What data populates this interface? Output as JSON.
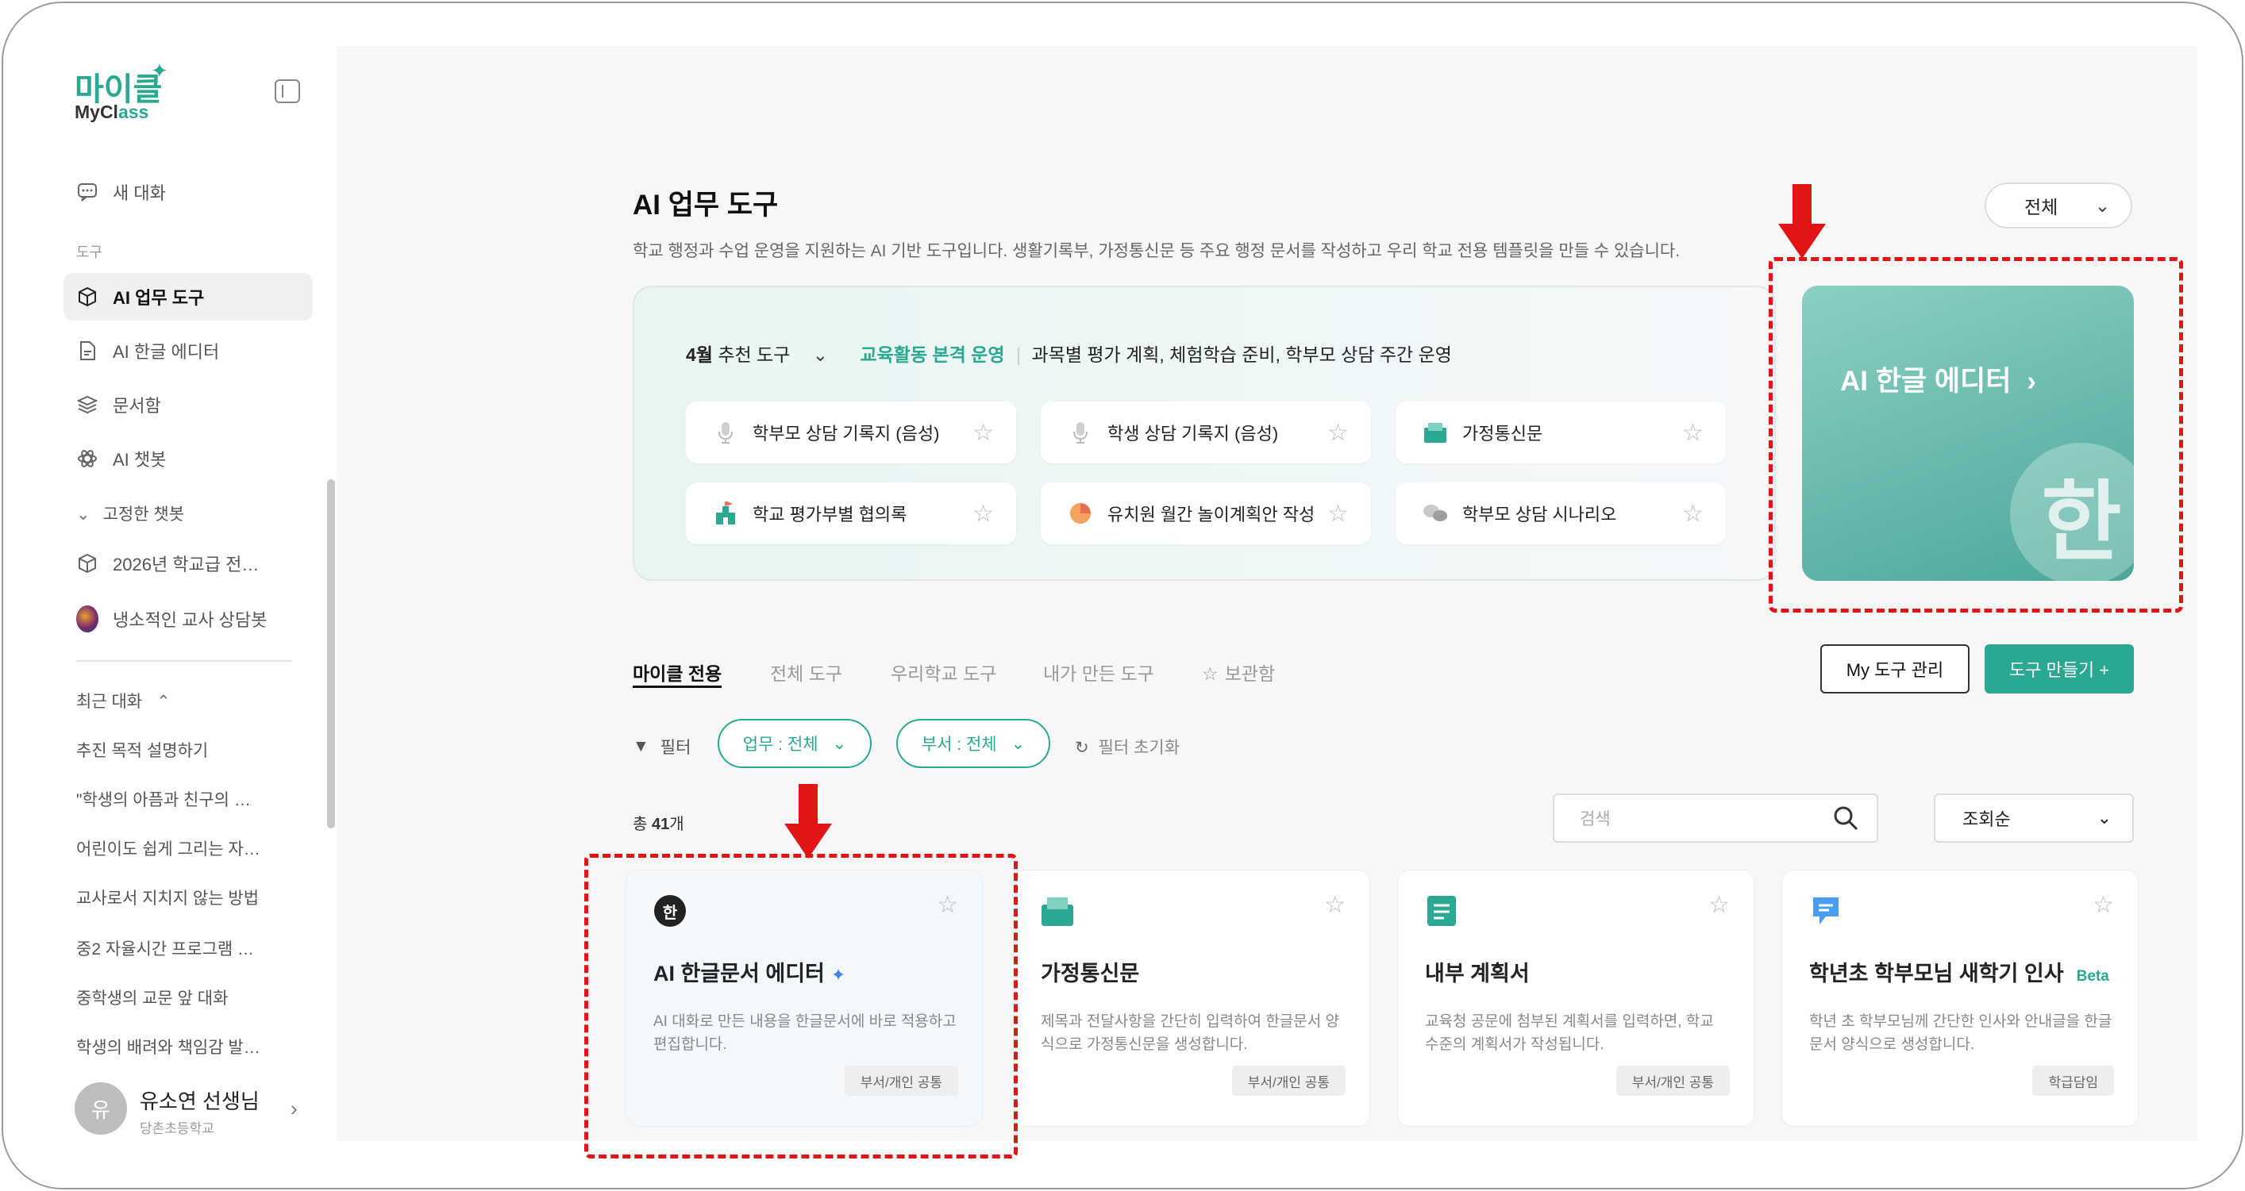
{
  "sidebar": {
    "logo_kr": "마이클",
    "logo_en_a": "MyCl",
    "logo_en_b": "ass",
    "new_chat": "새 대화",
    "section_tools": "도구",
    "items": [
      {
        "label": "AI 업무 도구",
        "icon": "cube-icon"
      },
      {
        "label": "AI 한글 에디터",
        "icon": "document-icon"
      },
      {
        "label": "문서함",
        "icon": "layers-icon"
      },
      {
        "label": "AI 챗봇",
        "icon": "atom-icon"
      }
    ],
    "pinned_label": "고정한 챗봇",
    "pinned": [
      "2026년 학교급 전…",
      "냉소적인 교사 상담봇"
    ],
    "recent_label": "최근 대화",
    "recent": [
      "추진 목적 설명하기",
      "\"학생의 아픔과 친구의 …",
      "어린이도 쉽게 그리는 자…",
      "교사로서 지치지 않는 방법",
      "중2 자율시간 프로그램 …",
      "중학생의 교문 앞 대화",
      "학생의 배려와 책임감 발…"
    ],
    "user": {
      "avatar": "유",
      "name": "유소연 선생님",
      "school": "당촌초등학교"
    }
  },
  "header": {
    "title": "AI 업무 도구",
    "description": "학교 행정과 수업 운영을 지원하는 AI 기반 도구입니다. 생활기록부, 가정통신문 등 주요 행정 문서를 작성하고 우리 학교 전용 템플릿을 만들 수 있습니다.",
    "filter_select": "전체"
  },
  "banner": {
    "month": "4월",
    "label": "추천 도구",
    "highlight": "교육활동 본격 운영",
    "detail": "과목별 평가 계획, 체험학습 준비, 학부모 상담 주간 운영",
    "tools": [
      {
        "label": "학부모 상담 기록지 (음성)",
        "icon": "microphone-icon"
      },
      {
        "label": "학생 상담 기록지 (음성)",
        "icon": "microphone-icon"
      },
      {
        "label": "가정통신문",
        "icon": "newsletter-icon"
      },
      {
        "label": "학교 평가부별 협의록",
        "icon": "school-icon"
      },
      {
        "label": "유치원 월간 놀이계획안 작성",
        "icon": "pie-icon"
      },
      {
        "label": "학부모 상담 시나리오",
        "icon": "chat-bubbles-icon"
      }
    ]
  },
  "hangul_card": {
    "label": "AI 한글 에디터",
    "glyph": "한"
  },
  "tabs": [
    "마이클 전용",
    "전체 도구",
    "우리학교 도구",
    "내가 만든 도구",
    "보관함"
  ],
  "buttons": {
    "my_tools": "My 도구 관리",
    "make_tool": "도구 만들기 +"
  },
  "filters": {
    "label": "필터",
    "work": "업무 : 전체",
    "dept": "부서 : 전체",
    "reset": "필터 초기화"
  },
  "total": {
    "prefix": "총 ",
    "count": "41",
    "suffix": "개"
  },
  "search": {
    "placeholder": "검색"
  },
  "sort": "조회순",
  "cards": [
    {
      "title": "AI 한글문서 에디터",
      "desc": "AI 대화로 만든 내용을 한글문서에 바로 적용하고 편집합니다.",
      "tag": "부서/개인 공통",
      "icon": "hangul-logo-icon"
    },
    {
      "title": "가정통신문",
      "desc": "제목과 전달사항을 간단히 입력하여 한글문서 양식으로 가정통신문을 생성합니다.",
      "tag": "부서/개인 공통",
      "icon": "newsletter-icon"
    },
    {
      "title": "내부 계획서",
      "desc": "교육청 공문에 첨부된 계획서를 입력하면, 학교 수준의 계획서가 작성됩니다.",
      "tag": "부서/개인 공통",
      "icon": "plan-doc-icon"
    },
    {
      "title": "학년초 학부모님 새학기 인사",
      "beta": "Beta",
      "desc": "학년 초 학부모님께 간단한 인사와 안내글을 한글문서 양식으로 생성합니다.",
      "tag": "학급담임",
      "icon": "speech-icon"
    }
  ],
  "colors": {
    "accent": "#2aa892",
    "annotation": "#e01515"
  }
}
